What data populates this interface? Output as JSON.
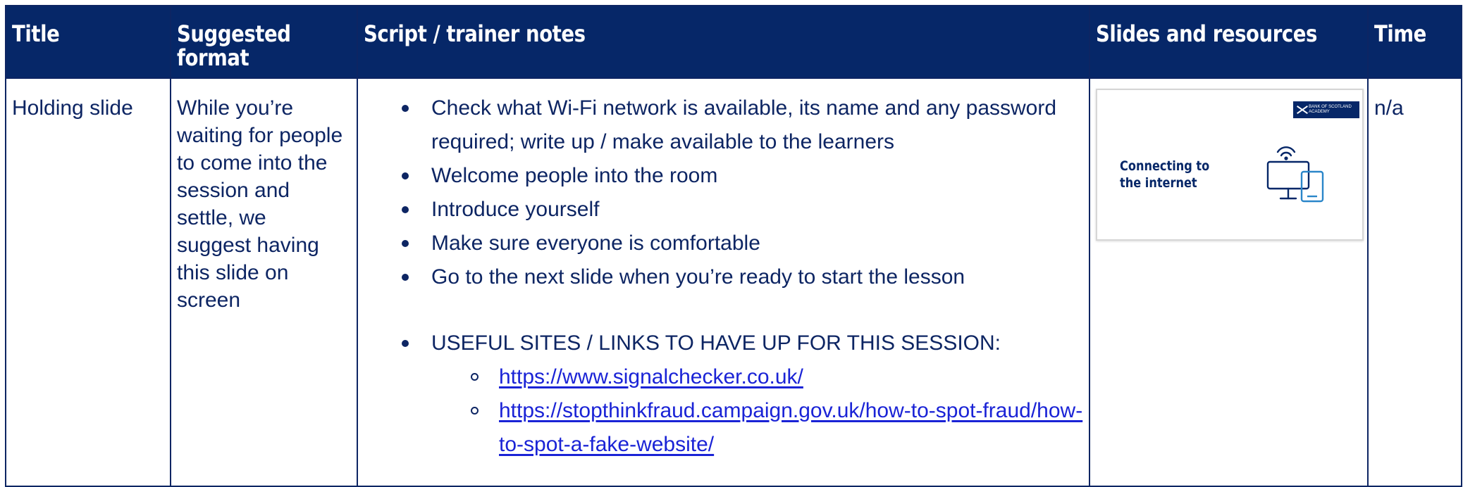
{
  "table": {
    "headers": {
      "title": "Title",
      "format": "Suggested format",
      "script": "Script / trainer notes",
      "slides": "Slides and resources",
      "time": "Time"
    },
    "row": {
      "title": "Holding slide",
      "format": "While you’re waiting for people to come into the session and settle, we suggest having this slide on screen",
      "notes": [
        "Check what Wi-Fi network is available, its name and any password required; write up / make available to the learners",
        "Welcome people into the room",
        "Introduce yourself",
        "Make sure everyone is comfortable",
        "Go to the next slide when you’re ready to start the lesson"
      ],
      "useful_heading": "USEFUL SITES / LINKS TO HAVE UP FOR THIS SESSION:",
      "links": [
        "https://www.signalchecker.co.uk/",
        "https://stopthinkfraud.campaign.gov.uk/how-to-spot-fraud/how-to-spot-a-fake-website/"
      ],
      "slide": {
        "logo_text": "BANK OF SCOTLAND ACADEMY",
        "title": "Connecting to\nthe internet",
        "icon": "wifi-devices-icon"
      },
      "time": "n/a"
    }
  },
  "colors": {
    "header_bg": "#062768",
    "text": "#0d2563",
    "link": "#1a23d6"
  }
}
